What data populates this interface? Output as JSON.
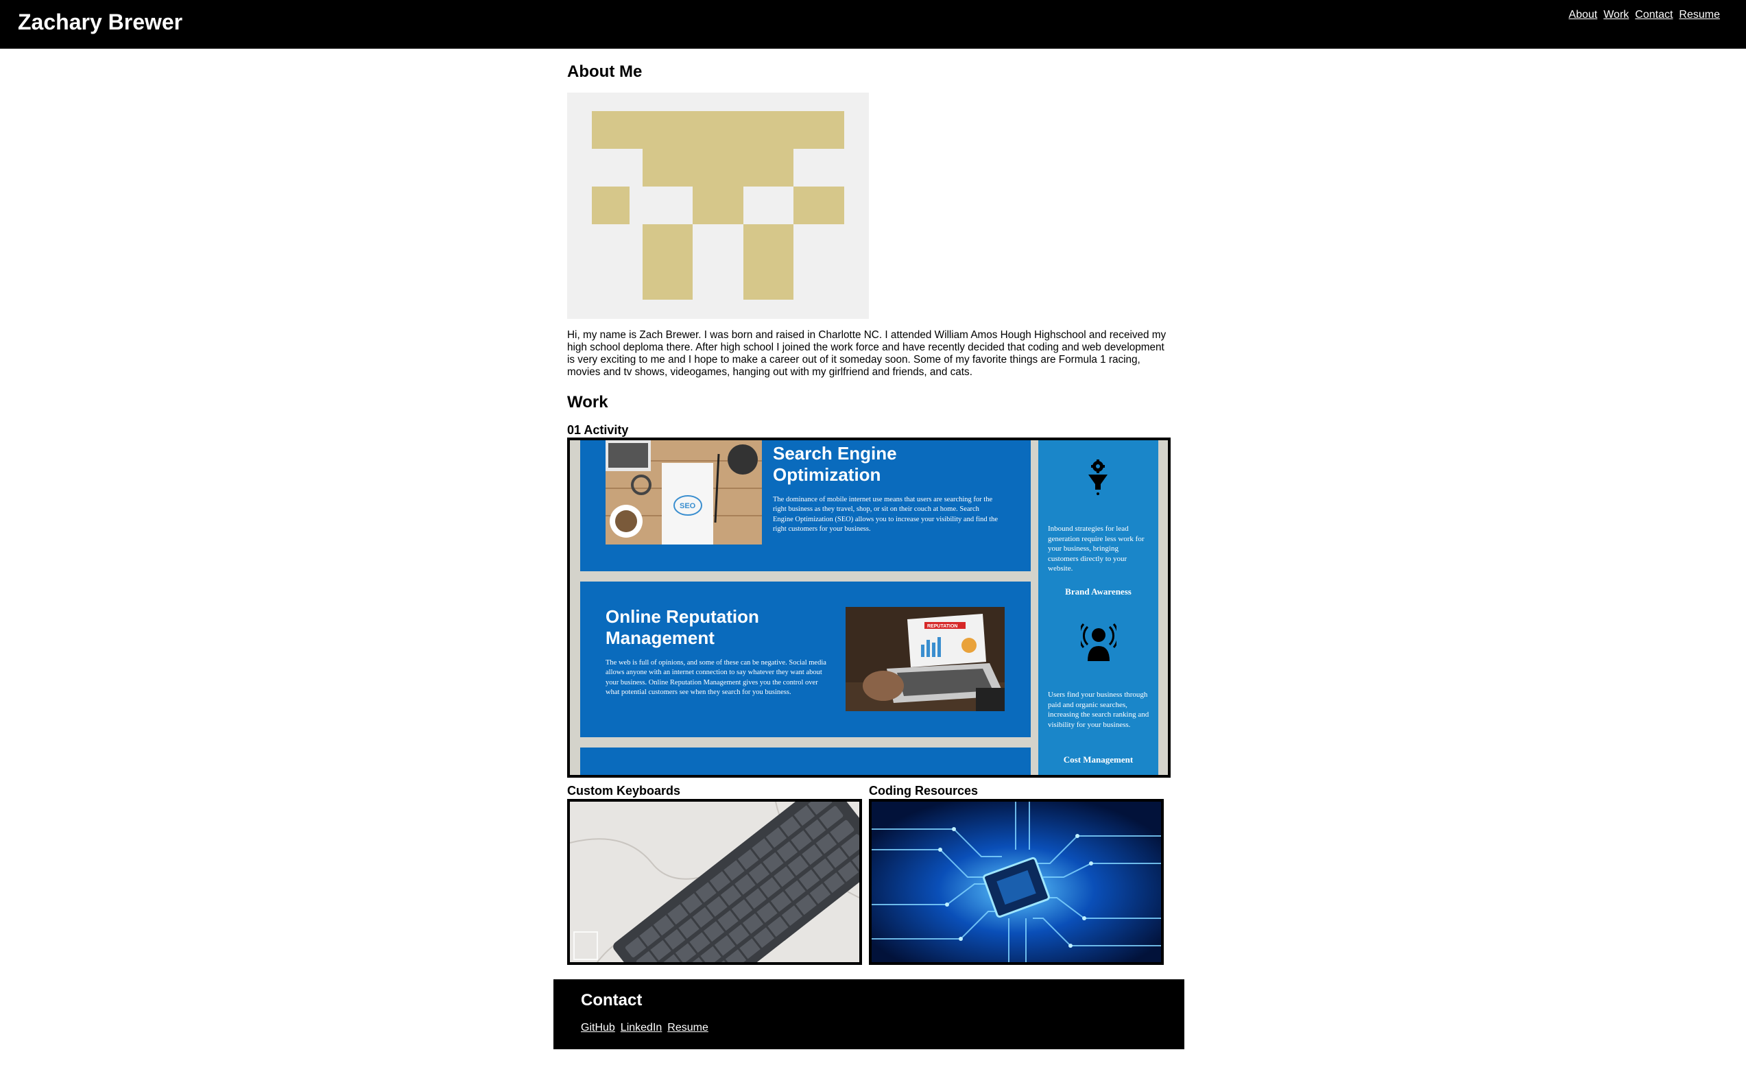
{
  "header": {
    "title": "Zachary Brewer",
    "nav": [
      "About",
      "Work",
      "Contact",
      "Resume"
    ]
  },
  "about": {
    "heading": "About Me",
    "text": "Hi, my name is Zach Brewer. I was born and raised in Charlotte NC. I attended William Amos Hough Highschool and received my high school deploma there. After high school I joined the work force and have recently decided that coding and web development is very exciting to me and I hope to make a career out of it someday soon. Some of my favorite things are Formula 1 racing, movies and tv shows, videogames, hanging out with my girlfriend and friends, and cats."
  },
  "work": {
    "heading": "Work",
    "projects": [
      {
        "title": "01 Activity",
        "screenshot": {
          "card1_heading": "Search Engine Optimization",
          "card1_body": "The dominance of mobile internet use means that users are searching for the right business as they travel, shop, or sit on their couch at home. Search Engine Optimization (SEO) allows you to increase your visibility and find the right customers for your business.",
          "card2_heading": "Online Reputation Management",
          "card2_body": "The web is full of opinions, and some of these can be negative. Social media allows anyone with an internet connection to say whatever they want about your business. Online Reputation Management gives you the control over what potential customers see when they search for you business.",
          "side_text1": "Inbound strategies for lead generation require less work for your business, bringing customers directly to your website.",
          "side_label1": "Brand Awareness",
          "side_text2": "Users find your business through paid and organic searches, increasing the search ranking and visibility for your business.",
          "side_label2": "Cost Management",
          "laptop_banner": "REPUTATION",
          "notebook_label": "SEO"
        }
      },
      {
        "title": "Custom Keyboards"
      },
      {
        "title": "Coding Resources"
      }
    ]
  },
  "contact": {
    "heading": "Contact",
    "links": [
      "GitHub",
      "LinkedIn",
      "Resume"
    ]
  },
  "colors": {
    "header_bg": "#000000",
    "avatar_gold": "#d6c78a",
    "avatar_bg": "#f0f0f0",
    "seo_blue": "#0a6bbd",
    "side_blue": "#1a86c9",
    "circuit_blue": "#0a4fb8"
  }
}
